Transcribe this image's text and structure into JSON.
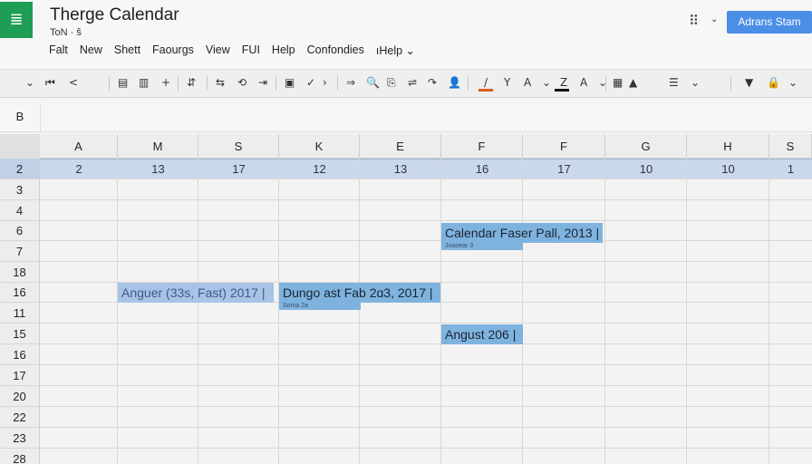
{
  "app": {
    "title": "Therge Calendar",
    "subtitle": "ToN · ŝ",
    "logo_glyph": "≣",
    "account_label": "Adrans Stam",
    "accent_color": "#4a8ee6",
    "logo_color": "#1f9d55"
  },
  "menu": {
    "items": [
      "Falt",
      "New",
      "Shett",
      "Faourgs",
      "View",
      "FUI",
      "Help",
      "Confondies",
      "ıHelp ⌄"
    ]
  },
  "toolbar": {
    "icons": [
      {
        "name": "chevron-down-icon",
        "glyph": "⌄"
      },
      {
        "name": "undo-icon",
        "glyph": "⏮"
      },
      {
        "name": "back-icon",
        "glyph": "<"
      },
      {
        "name": "print-icon",
        "glyph": "▤"
      },
      {
        "name": "columns-icon",
        "glyph": "▥"
      },
      {
        "name": "add-icon",
        "glyph": "+"
      },
      {
        "name": "filter-icon",
        "glyph": "⇵"
      },
      {
        "name": "format-paint-icon",
        "glyph": "⇆"
      },
      {
        "name": "link-icon",
        "glyph": "⟲"
      },
      {
        "name": "redo-icon",
        "glyph": "⇥"
      },
      {
        "name": "table-icon",
        "glyph": "▣"
      },
      {
        "name": "check-icon",
        "glyph": "✓"
      },
      {
        "name": "arrow-icon",
        "glyph": "›"
      },
      {
        "name": "comment-icon",
        "glyph": "⇒"
      },
      {
        "name": "search-icon",
        "glyph": "🔍"
      },
      {
        "name": "highlight-icon",
        "glyph": "⎘"
      },
      {
        "name": "swap-icon",
        "glyph": "⇌"
      },
      {
        "name": "redo-alt-icon",
        "glyph": "↷"
      },
      {
        "name": "user-icon",
        "glyph": "👤"
      },
      {
        "name": "text-color-icon",
        "glyph": "/"
      },
      {
        "name": "merge-icon",
        "glyph": "Y"
      },
      {
        "name": "fill-color-icon",
        "glyph": "A"
      },
      {
        "name": "dropdown-icon",
        "glyph": "⌄"
      },
      {
        "name": "strike-icon",
        "glyph": "Z"
      },
      {
        "name": "font-color-icon",
        "glyph": "A"
      },
      {
        "name": "dropdown2-icon",
        "glyph": "⌄"
      },
      {
        "name": "grid-icon",
        "glyph": "▦"
      },
      {
        "name": "triangle-icon",
        "glyph": "▲"
      },
      {
        "name": "list-icon",
        "glyph": "☰"
      },
      {
        "name": "dropdown3-icon",
        "glyph": "⌄"
      },
      {
        "name": "down-triangle-icon",
        "glyph": "▼"
      },
      {
        "name": "lock-icon",
        "glyph": "🔒"
      },
      {
        "name": "dropdown4-icon",
        "glyph": "⌄"
      }
    ]
  },
  "formula_bar": {
    "cell_ref": "B"
  },
  "grid": {
    "columns": [
      "A",
      "M",
      "S",
      "K",
      "E",
      "F",
      "F",
      "G",
      "H",
      "S"
    ],
    "rows": [
      "2",
      "3",
      "4",
      "6",
      "7",
      "18",
      "16",
      "11",
      "15",
      "16",
      "17",
      "20",
      "22",
      "23",
      "28"
    ],
    "selected_row_values": [
      "2",
      "13",
      "17",
      "12",
      "13",
      "16",
      "17",
      "10",
      "10",
      "1"
    ]
  },
  "events": [
    {
      "title": "Calendar Faser Pall, 2013 |",
      "sub": "Jnaoear 3"
    },
    {
      "title": "Anguer (33s, Fast) 2017 |",
      "sub": ""
    },
    {
      "title": "Dungo ast Fab 2ɑ3, 2017 |",
      "sub": "Soma 2a"
    },
    {
      "title": "Angust 206 |",
      "sub": ""
    }
  ],
  "colors": {
    "selected_row": "#c9d8ea",
    "event_bg": "#7fb3df",
    "event_faded_bg": "#a9c3e6"
  }
}
